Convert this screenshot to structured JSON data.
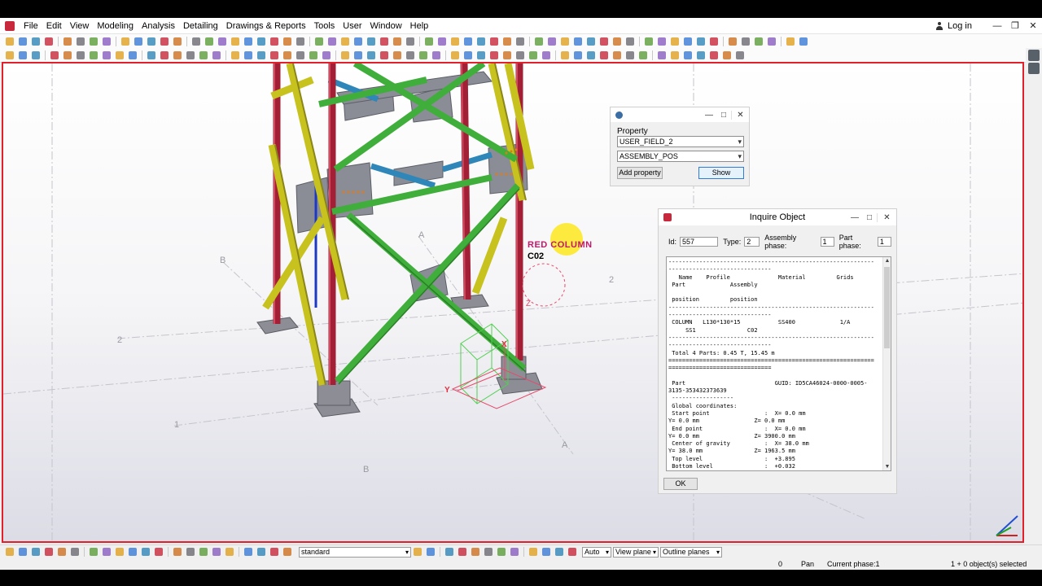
{
  "menubar": {
    "items": [
      "File",
      "Edit",
      "View",
      "Modeling",
      "Analysis",
      "Detailing",
      "Drawings & Reports",
      "Tools",
      "User",
      "Window",
      "Help"
    ],
    "login": "Log in"
  },
  "viewport": {
    "grid_labels": [
      "2",
      "B",
      "A",
      "2",
      "1",
      "B",
      "A"
    ],
    "column_label": "RED COLUMN",
    "column_mark": "C02",
    "axis_z": "Z",
    "axis_y": "Y",
    "axis_x": "X"
  },
  "property_dialog": {
    "label": "Property",
    "field1": "USER_FIELD_2",
    "field2": "ASSEMBLY_POS",
    "add_button": "Add property",
    "show_button": "Show"
  },
  "inquire_dialog": {
    "title": "Inquire Object",
    "id_label": "Id:",
    "id_value": "557",
    "type_label": "Type:",
    "type_value": "2",
    "assembly_phase_label": "Assembly phase:",
    "assembly_phase_value": "1",
    "part_phase_label": "Part phase:",
    "part_phase_value": "1",
    "report_lines": [
      "------------------------------------------------------------",
      "------------------------------",
      "   Name    Profile              Material         Grids",
      " Part             Assembly",
      "",
      " position         position",
      "------------------------------------------------------------",
      "------------------------------",
      " COLUMN   L130*130*15           SS400             1/A",
      "     SS1               C02",
      "------------------------------------------------------------",
      "------------------------------",
      " Total 4 Parts: 0.45 T, 15.45 m",
      "============================================================",
      "==============================",
      "",
      " Part                          GUID: ID5CA46024-0000-0005-",
      "3135-353432373639",
      " ------------------",
      " Global coordinates:",
      " Start point                :  X= 0.0 mm",
      "Y= 0.0 mm                Z= 0.0 mm",
      " End point                  :  X= 0.0 mm",
      "Y= 0.0 mm                Z= 3900.0 mm",
      " Center of gravity          :  X= 38.0 mm",
      "Y= 38.0 mm               Z= 1963.5 mm",
      " Top level                  :  +3.895",
      " Bottom level               :  +0.032"
    ],
    "ok_button": "OK"
  },
  "bottom_toolbar": {
    "work_plane": "standard",
    "auto": "Auto",
    "view_plane": "View plane",
    "outline_planes": "Outline planes"
  },
  "statusbar": {
    "count": "0",
    "mode": "Pan",
    "phase": "Current phase:1",
    "selection": "1 + 0 object(s) selected"
  }
}
